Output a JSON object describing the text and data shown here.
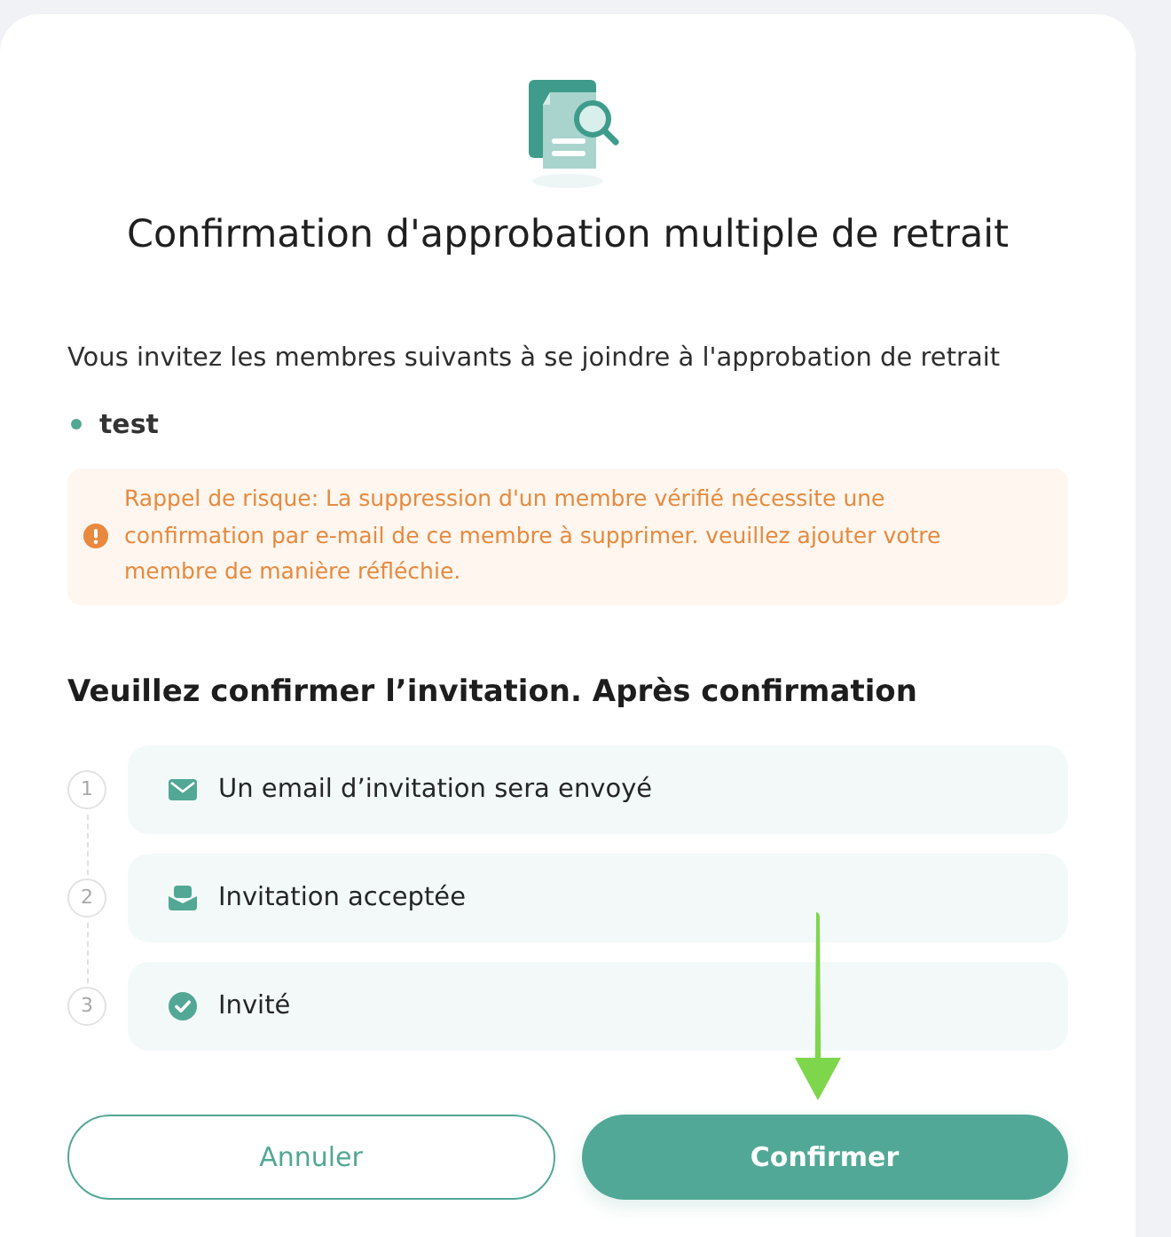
{
  "dialog": {
    "title": "Confirmation d'approbation multiple de retrait",
    "intro": "Vous invitez les membres suivants à se joindre à l'approbation de retrait"
  },
  "members": [
    {
      "name": "test"
    }
  ],
  "risk_notice": {
    "text": "Rappel de risque: La suppression d'un membre vérifié nécessite une confirmation par e-mail de ce membre à supprimer. veuillez ajouter votre membre de manière réfléchie."
  },
  "steps_heading": "Veuillez confirmer l’invitation. Après confirmation",
  "steps": [
    {
      "number": "1",
      "kind": "email",
      "label": "Un email d’invitation sera envoyé"
    },
    {
      "number": "2",
      "kind": "accepted",
      "label": "Invitation acceptée"
    },
    {
      "number": "3",
      "kind": "done",
      "label": "Invité"
    }
  ],
  "buttons": [
    {
      "kind": "secondary",
      "label": "Annuler"
    },
    {
      "kind": "primary",
      "label": "Confirmer"
    }
  ],
  "annotation_arrow": {
    "kind": "down"
  }
}
